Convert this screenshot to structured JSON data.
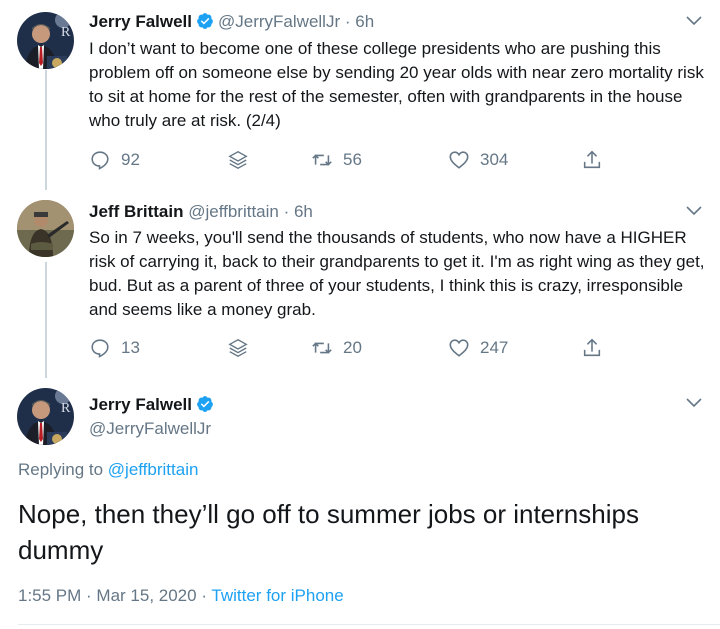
{
  "tweets": [
    {
      "name": "Jerry Falwell",
      "handle": "@JerryFalwellJr",
      "time": "· 6h",
      "text": "I don’t want to become one of these college presidents who are pushing this problem off on someone else by sending 20 year olds with near zero mortality risk to sit at home for the rest of the semester, often with grandparents in the house who truly are at risk. (2/4)",
      "replies": "92",
      "retweets": "56",
      "likes": "304"
    },
    {
      "name": "Jeff Brittain",
      "handle": "@jeffbrittain",
      "time": "· 6h",
      "text": "So in 7 weeks, you'll send the thousands of students, who now have a HIGHER risk of carrying it, back to their grandparents to get it. I'm as right wing as they get, bud. But as a parent of three of your students, I think this is crazy, irresponsible and seems like a money grab.",
      "replies": "13",
      "retweets": "20",
      "likes": "247"
    }
  ],
  "main_tweet": {
    "name": "Jerry Falwell",
    "handle": "@JerryFalwellJr",
    "replying_prefix": "Replying to ",
    "replying_handle": "@jeffbrittain",
    "text": "Nope, then they’ll go off to summer jobs or internships dummy",
    "timestamp": "1:55 PM · Mar 15, 2020 · ",
    "source": "Twitter for iPhone"
  },
  "colors": {
    "accent": "#1da1f2",
    "muted": "#657786",
    "text": "#14171a"
  }
}
